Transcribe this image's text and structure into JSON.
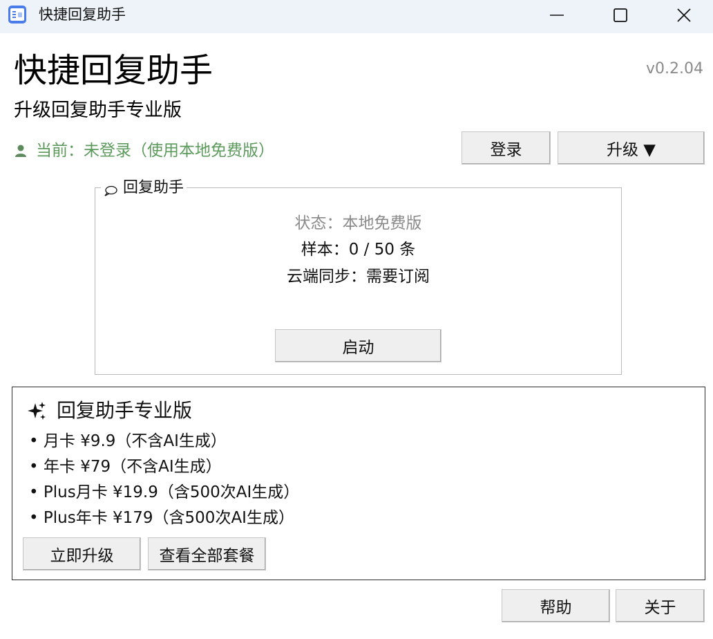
{
  "window": {
    "title": "快捷回复助手",
    "icon": "app-list-icon",
    "controls": [
      "minimize-icon",
      "maximize-icon",
      "close-icon"
    ]
  },
  "header": {
    "app_title": "快捷回复助手",
    "version": "v0.2.04",
    "subtitle": "升级回复助手专业版",
    "status_text": "当前：未登录（使用本地免费版）",
    "status_icon": "user-icon",
    "login_label": "登录",
    "upgrade_label": "升级 ▼"
  },
  "assistant_group": {
    "legend": "回复助手",
    "legend_icon": "speech-bubble-icon",
    "status": "状态：本地免费版",
    "samples": "样本：0 / 50 条",
    "cloud_sync": "云端同步：需要订阅",
    "start_label": "启动"
  },
  "pro_panel": {
    "title": "回复助手专业版",
    "title_icon": "sparkle-icon",
    "plans": [
      "• 月卡 ¥9.9（不含AI生成）",
      "• 年卡 ¥79（不含AI生成）",
      "• Plus月卡 ¥19.9（含500次AI生成）",
      "• Plus年卡 ¥179（含500次AI生成）"
    ],
    "upgrade_now_label": "立即升级",
    "view_all_label": "查看全部套餐"
  },
  "footer": {
    "help_label": "帮助",
    "about_label": "关于"
  },
  "colors": {
    "titlebar_bg": "#eef3f9",
    "status_green": "#5c9a5c",
    "muted_gray": "#8a8a8a",
    "button_bg": "#efefef"
  }
}
